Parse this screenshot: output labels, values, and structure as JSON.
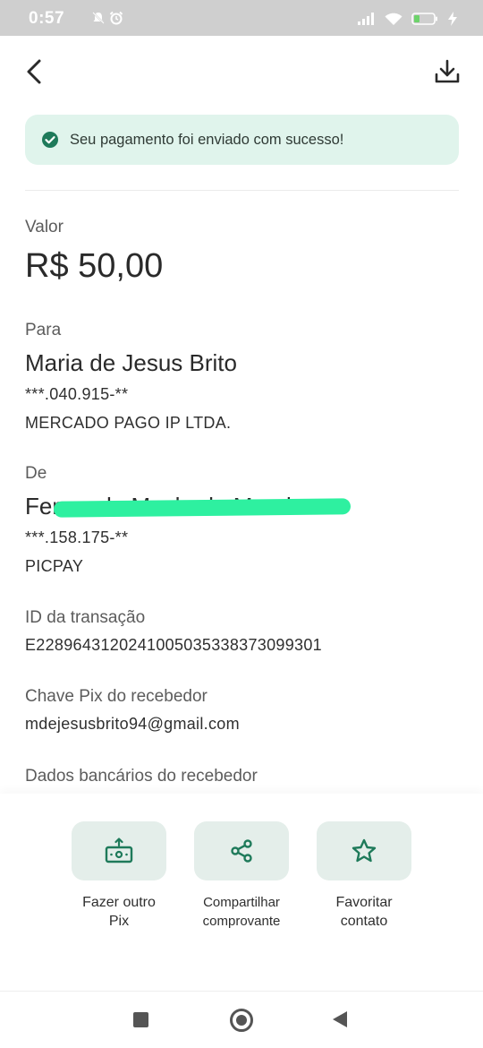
{
  "status_bar": {
    "time": "0:57"
  },
  "banner": {
    "message": "Seu pagamento foi enviado com sucesso!"
  },
  "details": {
    "valor_label": "Valor",
    "valor": "R$ 50,00",
    "para_label": "Para",
    "para_nome": "Maria de Jesus Brito",
    "para_documento": "***.040.915-**",
    "para_instituicao": "MERCADO PAGO IP LTDA.",
    "de_label": "De",
    "de_nome": "Fernando Machado Moreira",
    "de_documento": "***.158.175-**",
    "de_instituicao": "PICPAY",
    "id_label": "ID da transação",
    "id_valor": "E22896431202410050353383730993​01",
    "chave_label": "Chave Pix do recebedor",
    "chave_valor": "mdejesusbrito94@gmail.com",
    "dados_label": "Dados bancários do recebedor"
  },
  "actions": [
    {
      "label_line1": "Fazer outro",
      "label_line2": "Pix",
      "icon": "cash-upload-icon"
    },
    {
      "label_line1": "Compartilhar",
      "label_line2": "comprovante",
      "icon": "share-icon"
    },
    {
      "label_line1": "Favoritar",
      "label_line2": "contato",
      "icon": "star-icon"
    }
  ],
  "colors": {
    "accent": "#1e7a5a",
    "banner_bg": "#e0f4ec",
    "tile_bg": "#e4eeea",
    "status_bar_bg": "#cfcfcf"
  }
}
